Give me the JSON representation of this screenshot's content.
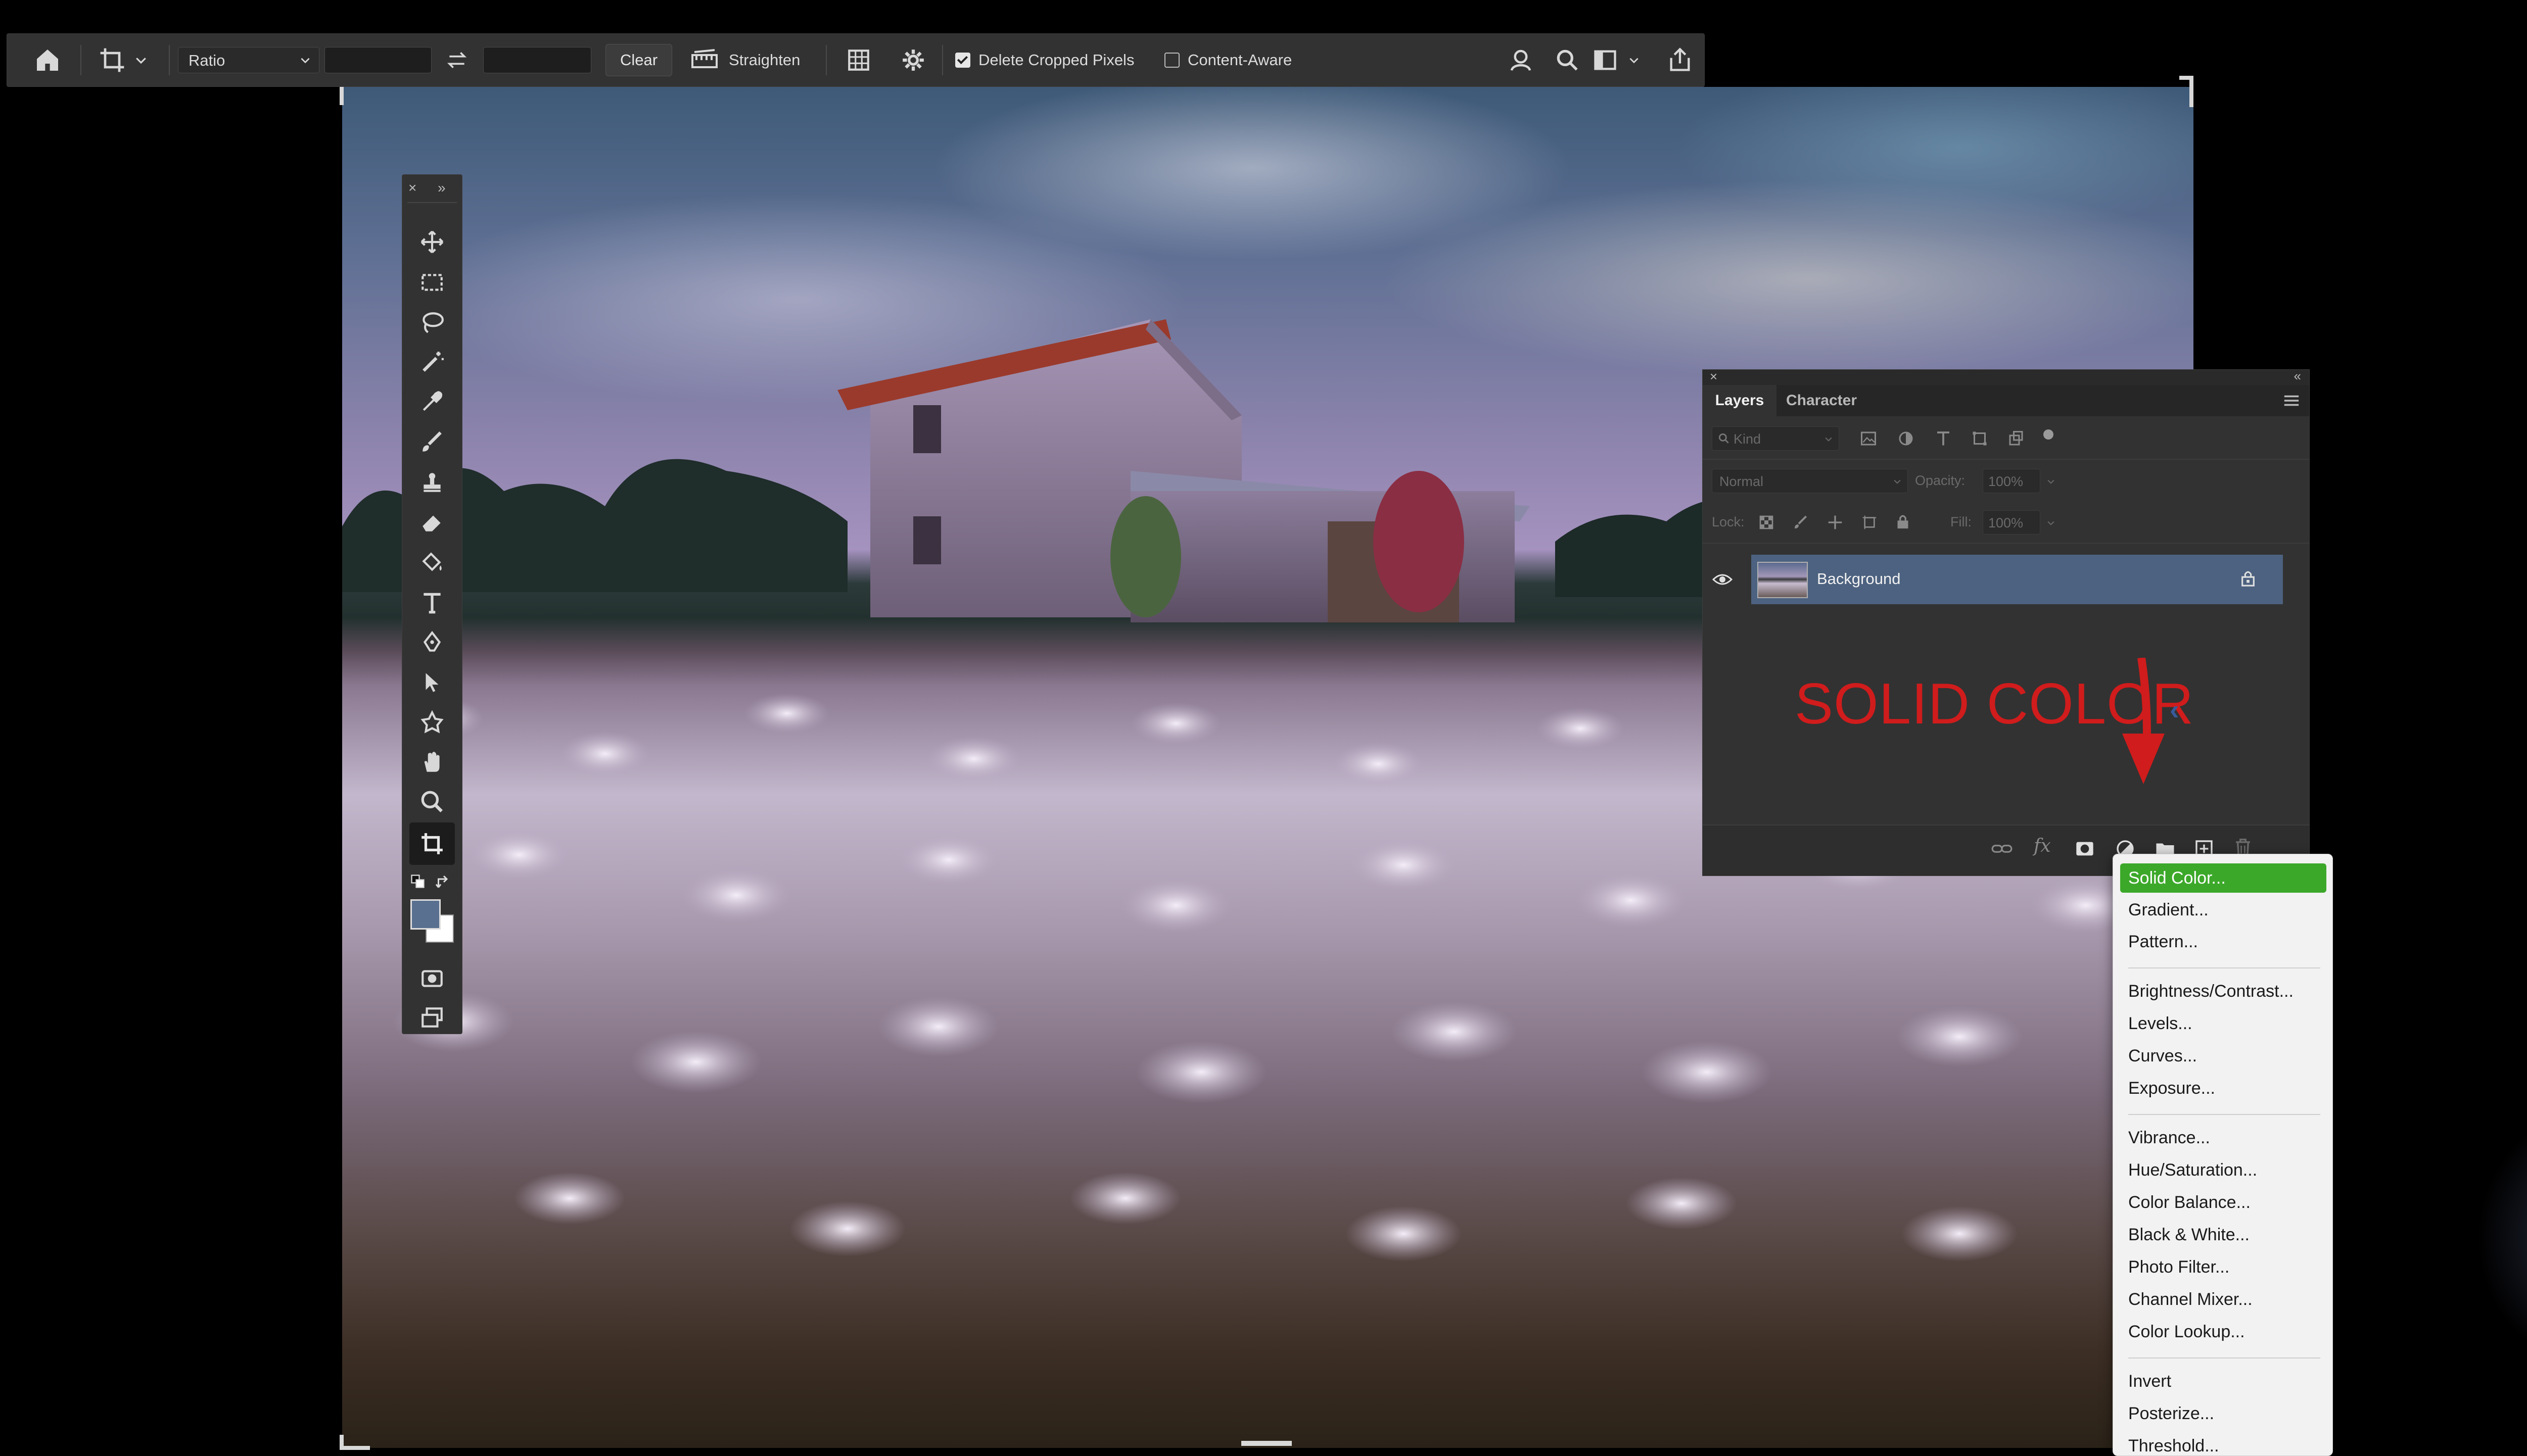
{
  "options_bar": {
    "ratio_label": "Ratio",
    "clear_label": "Clear",
    "straighten_label": "Straighten",
    "delete_cropped_label": "Delete Cropped Pixels",
    "delete_cropped_checked": true,
    "content_aware_label": "Content-Aware",
    "content_aware_checked": false
  },
  "tools_panel": {
    "tools": [
      "move-tool",
      "rectangular-marquee-tool",
      "lasso-tool",
      "magic-wand-tool",
      "eyedropper-tool",
      "brush-tool",
      "clone-stamp-tool",
      "eraser-tool",
      "paint-bucket-tool",
      "type-tool",
      "pen-tool",
      "path-selection-tool",
      "custom-shape-tool",
      "hand-tool",
      "zoom-tool",
      "crop-tool"
    ],
    "foreground_color": "#5a7090",
    "background_color": "#ffffff"
  },
  "layers_panel": {
    "tabs": [
      "Layers",
      "Character"
    ],
    "active_tab": "Layers",
    "filter_kind": "Kind",
    "blend_mode": "Normal",
    "opacity_label": "Opacity:",
    "opacity_value": "100%",
    "lock_label": "Lock:",
    "fill_label": "Fill:",
    "fill_value": "100%",
    "layers": [
      {
        "name": "Background",
        "visible": true,
        "locked": true,
        "selected": true
      }
    ]
  },
  "annotation": {
    "text": "SOLID COLOR",
    "color": "#d01c1c"
  },
  "adjustment_menu": {
    "highlight_color": "#3ca82a",
    "groups": [
      [
        "Solid Color...",
        "Gradient...",
        "Pattern..."
      ],
      [
        "Brightness/Contrast...",
        "Levels...",
        "Curves...",
        "Exposure..."
      ],
      [
        "Vibrance...",
        "Hue/Saturation...",
        "Color Balance...",
        "Black & White...",
        "Photo Filter...",
        "Channel Mixer...",
        "Color Lookup..."
      ],
      [
        "Invert",
        "Posterize...",
        "Threshold..."
      ]
    ],
    "highlighted": "Solid Color..."
  }
}
